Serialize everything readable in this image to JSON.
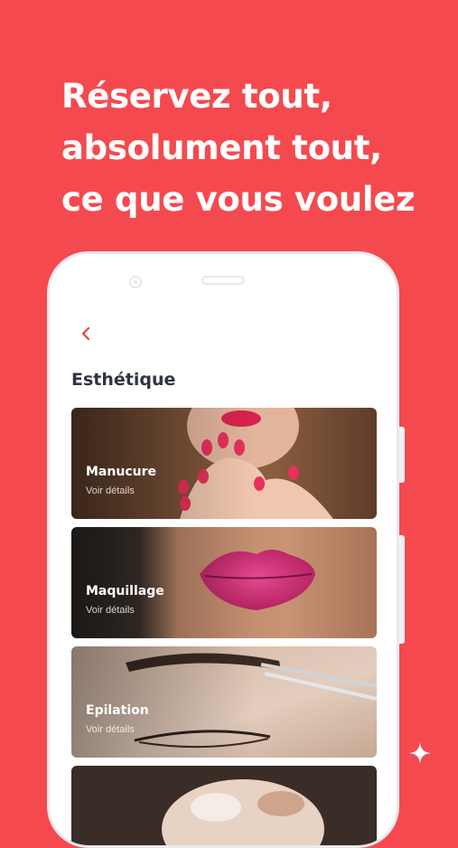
{
  "headline": {
    "lines": [
      "Réservez tout,",
      "absolument tout,",
      "ce que vous voulez"
    ]
  },
  "screen": {
    "back_icon": "chevron-left-icon",
    "title": "Esthétique",
    "categories": [
      {
        "title": "Manucure",
        "subtitle": "Voir détails"
      },
      {
        "title": "Maquillage",
        "subtitle": "Voir détails"
      },
      {
        "title": "Epilation",
        "subtitle": "Voir détails"
      },
      {
        "title": "",
        "subtitle": ""
      }
    ]
  },
  "colors": {
    "background": "#f44a4f",
    "accent": "#e8423f",
    "title_text": "#2f3442"
  }
}
